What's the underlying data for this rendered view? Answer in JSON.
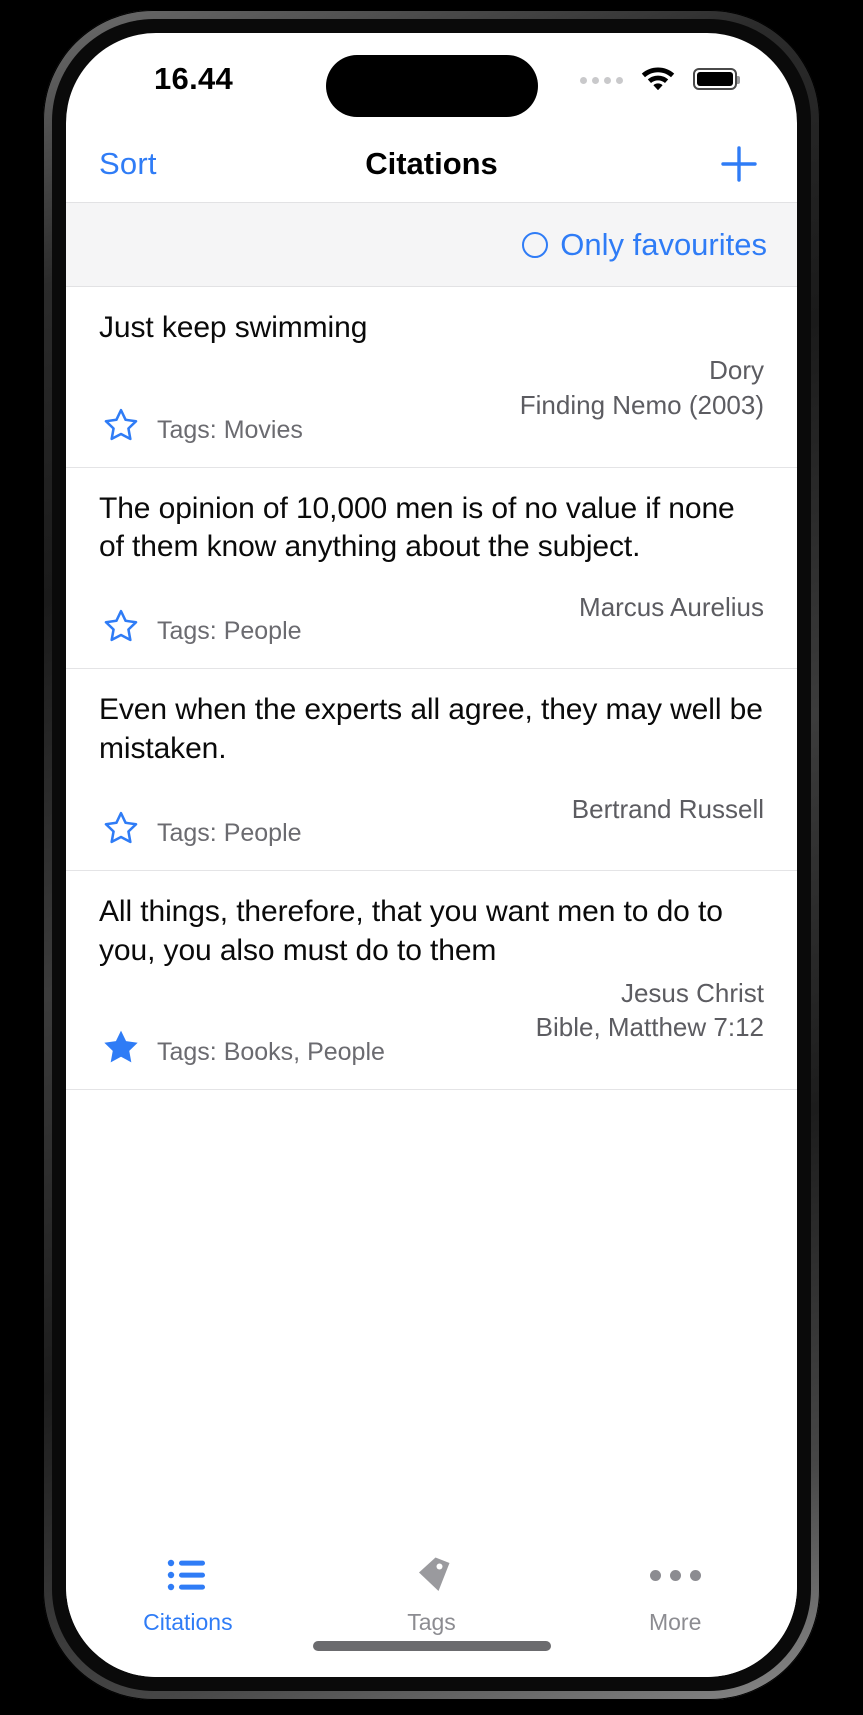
{
  "status_bar": {
    "time": "16.44",
    "signal_icon": "signal-dots-icon",
    "wifi_icon": "wifi-icon",
    "battery_icon": "battery-icon"
  },
  "nav_bar": {
    "sort_label": "Sort",
    "title": "Citations",
    "add_icon": "plus-icon"
  },
  "filter_bar": {
    "favourites_label": "Only favourites",
    "favourites_checked": false,
    "circle_icon": "circle-outline-icon"
  },
  "colors": {
    "accent": "#2f7cf6",
    "filter_bg": "#f5f5f6",
    "text_primary": "#0a0a0a",
    "text_secondary": "#5c5c61",
    "tag_text": "#6b6b70",
    "tab_inactive": "#8c8c91",
    "divider": "#e4e4e6"
  },
  "citations": [
    {
      "text": "Just keep swimming",
      "author": "Dory",
      "source": "Finding Nemo (2003)",
      "tags_label": "Tags: Movies",
      "favourite": false,
      "star_icon": "star-outline-icon"
    },
    {
      "text": "The opinion of 10,000 men is of no value if none of them know anything about the subject.",
      "author": "Marcus Aurelius",
      "source": "",
      "tags_label": "Tags: People",
      "favourite": false,
      "star_icon": "star-outline-icon"
    },
    {
      "text": "Even when the experts all agree, they may well be mistaken.",
      "author": "Bertrand Russell",
      "source": "",
      "tags_label": "Tags: People",
      "favourite": false,
      "star_icon": "star-outline-icon"
    },
    {
      "text": "All things, therefore, that you want men to do to you, you also must do to them",
      "author": "Jesus Christ",
      "source": "Bible, Matthew 7:12",
      "tags_label": "Tags: Books, People",
      "favourite": true,
      "star_icon": "star-filled-icon"
    }
  ],
  "tab_bar": {
    "tabs": [
      {
        "label": "Citations",
        "icon": "list-bullet-icon",
        "active": true
      },
      {
        "label": "Tags",
        "icon": "tag-icon",
        "active": false
      },
      {
        "label": "More",
        "icon": "ellipsis-icon",
        "active": false
      }
    ]
  }
}
